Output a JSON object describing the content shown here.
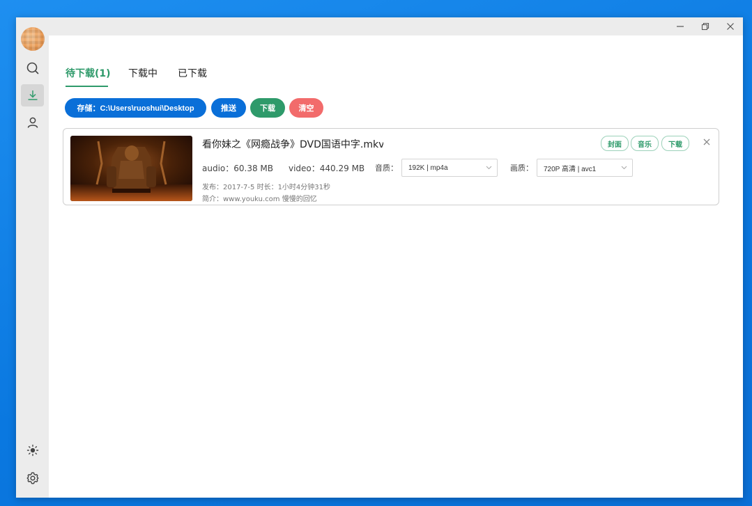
{
  "window_controls": {
    "minimize_icon": "minimize-icon",
    "restore_icon": "restore-icon",
    "close_icon": "close-icon"
  },
  "sidebar": {
    "items": [
      {
        "name": "search",
        "icon": "search-icon"
      },
      {
        "name": "download",
        "icon": "download-icon",
        "active": true
      },
      {
        "name": "user",
        "icon": "user-icon"
      },
      {
        "name": "theme",
        "icon": "sun-icon"
      },
      {
        "name": "settings",
        "icon": "gear-icon"
      }
    ]
  },
  "tabs": [
    {
      "label": "待下载(1)",
      "active": true
    },
    {
      "label": "下载中"
    },
    {
      "label": "已下载"
    }
  ],
  "toolbar": {
    "storage_label": "存储：C:\\Users\\ruoshui\\Desktop",
    "push_label": "推送",
    "download_label": "下载",
    "clear_label": "清空"
  },
  "item": {
    "title": "看你妹之《网瘾战争》DVD国语中字.mkv",
    "tags": [
      "封面",
      "音乐",
      "下载"
    ],
    "audio_size": "audio：60.38 MB",
    "video_size": "video：440.29 MB",
    "audio_quality_label": "音质：",
    "audio_quality_value": "192K | mp4a",
    "video_quality_label": "画质：",
    "video_quality_value": "720P 高清 | avc1",
    "published": "发布：2017-7-5 时长：1小时4分钟31秒",
    "intro": "简介：www.youku.com 慢慢的回忆"
  },
  "colors": {
    "accent_green": "#2e9a6a",
    "storage_blue": "#0a6fd8",
    "push_blue": "#0a6fd8",
    "download_green": "#2e9a6a",
    "clear_red": "#f26b6b"
  }
}
